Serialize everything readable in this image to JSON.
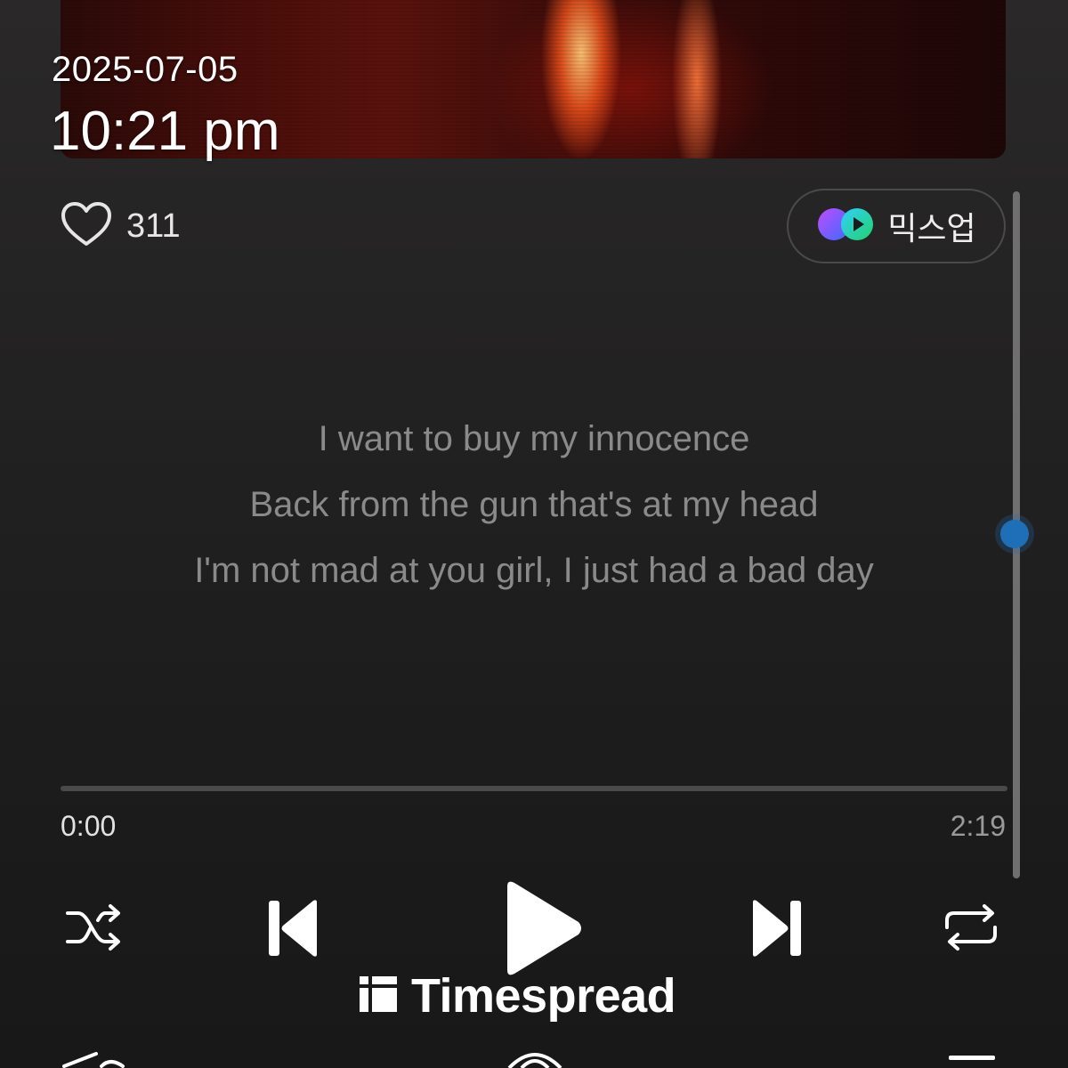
{
  "timestamp": {
    "date": "2025-07-05",
    "time": "10:21 pm"
  },
  "like": {
    "count": "311",
    "icon": "heart-outline-icon"
  },
  "mixup": {
    "label": "믹스업",
    "icon": "mixup-logo-icon"
  },
  "lyrics": {
    "lines": [
      "I want to buy my innocence",
      "Back from the gun that's at my head",
      "I'm not mad at you girl, I just had a bad day"
    ]
  },
  "playback": {
    "current_time": "0:00",
    "total_time": "2:19",
    "progress": 0.0
  },
  "controls": {
    "shuffle": "shuffle-icon",
    "previous": "skip-previous-icon",
    "play": "play-icon",
    "next": "skip-next-icon",
    "repeat": "repeat-icon"
  },
  "watermark": {
    "text": "Timespread"
  },
  "colors": {
    "accent_scroll": "#1e6fb8",
    "background": "#1c1c1c",
    "lyric_text": "#8a8a8a"
  }
}
